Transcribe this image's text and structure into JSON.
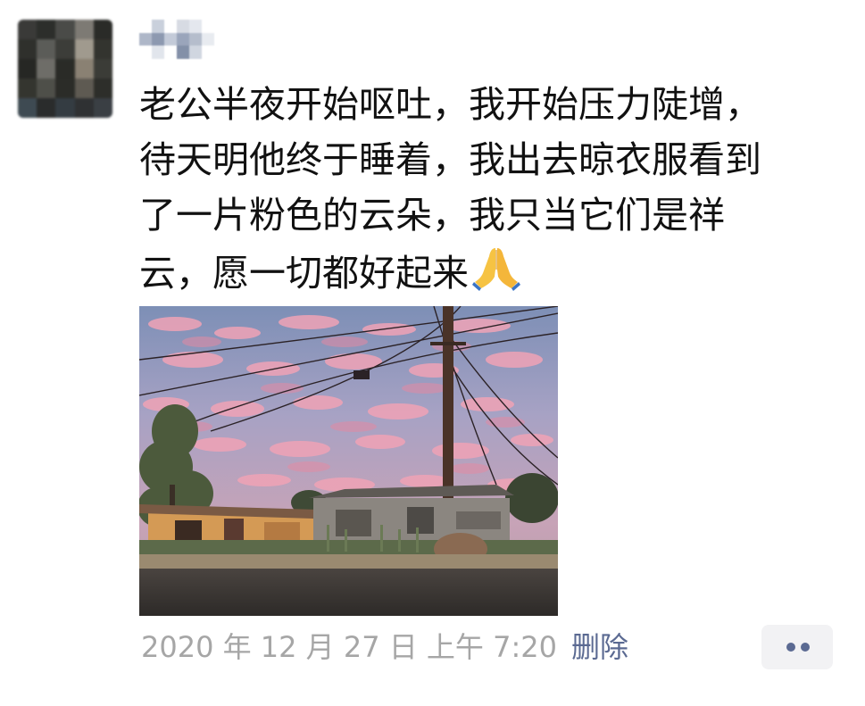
{
  "post": {
    "text_lines": [
      "老公半夜开始呕吐，我开始压力陡增，",
      "待天明他终于睡着，我出去晾衣服看到",
      "了一片粉色的云朵，我只当它们是祥",
      "云，愿一切都好起来"
    ],
    "emoji": "folded-hands",
    "photo_description_icon": "pink-clouds-photo",
    "timestamp": "2020 年 12 月 27 日 上午 7:20",
    "delete_label": "删除",
    "more_label": "••"
  },
  "colors": {
    "text": "#111111",
    "timestamp": "#a6a6a6",
    "link": "#5b6a92",
    "more_bg": "#f2f2f4"
  }
}
